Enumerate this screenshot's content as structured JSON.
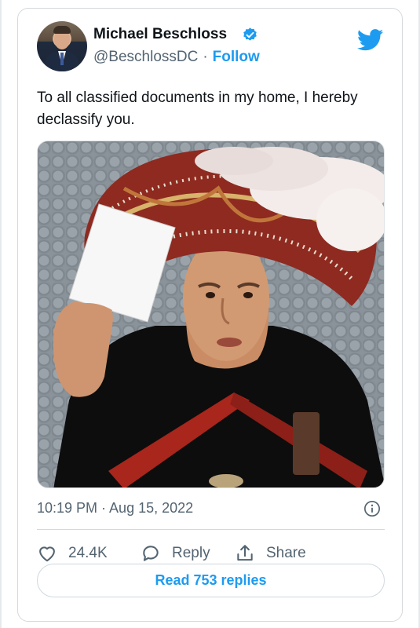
{
  "author": {
    "name": "Michael Beschloss",
    "handle": "@BeschlossDC",
    "separator": "·",
    "follow_label": "Follow"
  },
  "tweet": {
    "text": "To all classified documents in my home, I hereby declassify you.",
    "timestamp": "10:19 PM · Aug 15, 2022"
  },
  "actions": {
    "like_count": "24.4K",
    "reply_label": "Reply",
    "share_label": "Share"
  },
  "replies_button": "Read 753 replies",
  "icons": [
    "verified-badge-icon",
    "twitter-bird-icon",
    "info-icon",
    "heart-icon",
    "reply-bubble-icon",
    "share-icon"
  ],
  "colors": {
    "accent": "#1d9bf0",
    "secondary_text": "#536471",
    "text": "#0f1419"
  }
}
